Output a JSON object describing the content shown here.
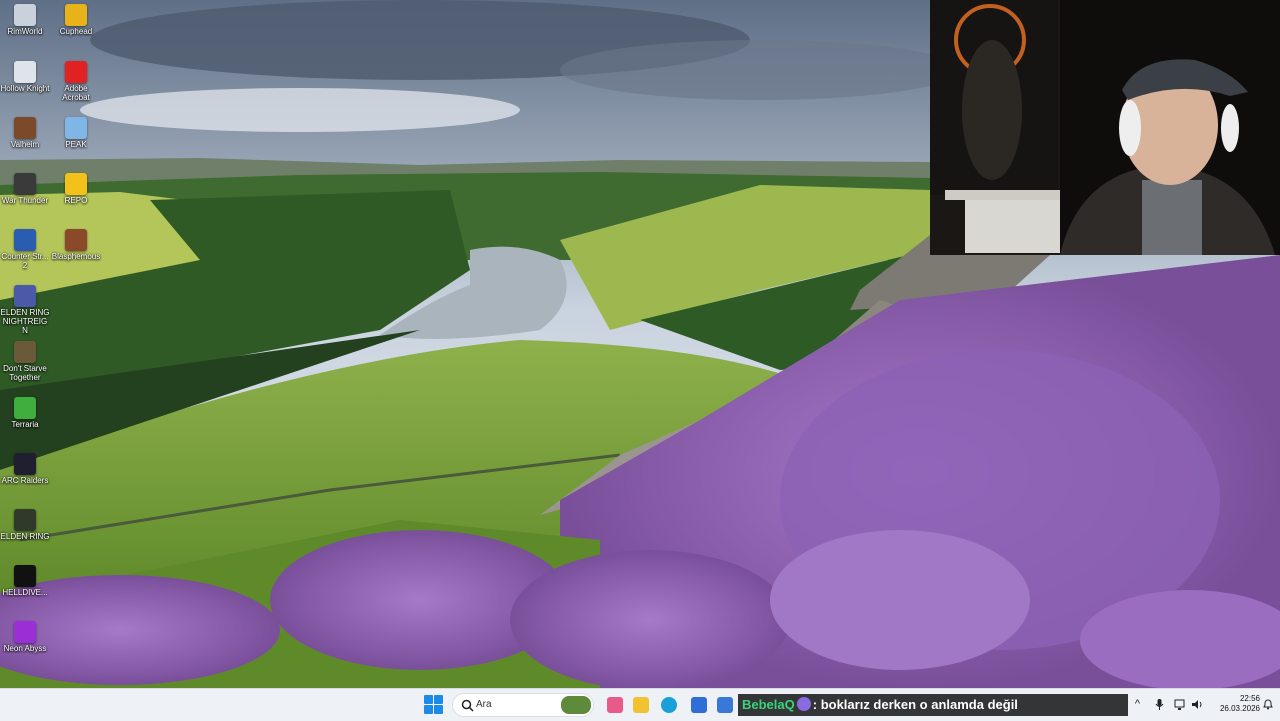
{
  "desktop": {
    "icons": [
      {
        "label": "RimWorld",
        "icon": "rimworld-icon",
        "color": "#c9d2dc"
      },
      {
        "label": "Cuphead",
        "icon": "cuphead-icon",
        "color": "#e8b21a"
      },
      {
        "label": "Hollow Knight",
        "icon": "hollow-knight-icon",
        "color": "#dfe3ea"
      },
      {
        "label": "Adobe Acrobat",
        "icon": "acrobat-icon",
        "color": "#e02222"
      },
      {
        "label": "Valheim",
        "icon": "valheim-icon",
        "color": "#7a4a2a"
      },
      {
        "label": "PEAK",
        "icon": "peak-icon",
        "color": "#7fb6e6"
      },
      {
        "label": "War Thunder",
        "icon": "war-thunder-icon",
        "color": "#3a3a3a"
      },
      {
        "label": "REPO",
        "icon": "repo-icon",
        "color": "#f2c21a"
      },
      {
        "label": "Counter Str... 2",
        "icon": "counter-strike-icon",
        "color": "#2a5db0"
      },
      {
        "label": "Blasphemous",
        "icon": "blasphemous-icon",
        "color": "#8a4a2a"
      },
      {
        "label": "ELDEN RING NIGHTREIGN",
        "icon": "elden-ring-nightreign-icon",
        "color": "#4a5aa8"
      },
      {
        "label": "Don't Starve Together",
        "icon": "dont-starve-icon",
        "color": "#6b5a3a"
      },
      {
        "label": "Terraria",
        "icon": "terraria-icon",
        "color": "#3fae3f"
      },
      {
        "label": "ARC Raiders",
        "icon": "arc-raiders-icon",
        "color": "#1f1f2f"
      },
      {
        "label": "ELDEN RING",
        "icon": "elden-ring-icon",
        "color": "#2f3a2a"
      },
      {
        "label": "HELLDIVE...",
        "icon": "helldivers-icon",
        "color": "#111111"
      },
      {
        "label": "Neon Abyss",
        "icon": "neon-abyss-icon",
        "color": "#9a2fd6"
      }
    ]
  },
  "taskbar": {
    "search_placeholder": "Ara",
    "apps": [
      {
        "icon": "news-icon",
        "color": "#e85a8a"
      },
      {
        "icon": "file-explorer-icon",
        "color": "#f2c230"
      },
      {
        "icon": "edge-icon",
        "color": "#1aa0d8"
      },
      {
        "icon": "store-icon",
        "color": "#2e6ed6"
      },
      {
        "icon": "mail-icon",
        "color": "#3a78d8"
      }
    ],
    "chat_overlay": {
      "username": "BebelaQ",
      "message": ": boklarız derken o anlamda değil"
    },
    "tray": {
      "chevron": "^",
      "time": "22:56",
      "date": "26.03.2026"
    }
  }
}
